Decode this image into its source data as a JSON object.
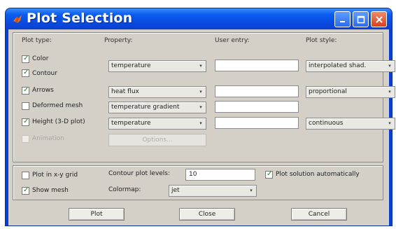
{
  "window": {
    "title": "Plot Selection",
    "title_bar_color": "#0a4ae0",
    "close_button_color": "#d8401e",
    "logo_icon": "matlab-logo-icon",
    "minimize_icon": "minimize-icon",
    "maximize_icon": "maximize-icon",
    "close_icon": "close-icon"
  },
  "headers": {
    "plot_type": "Plot type:",
    "property": "Property:",
    "user_entry": "User entry:",
    "plot_style": "Plot style:"
  },
  "rows": [
    {
      "label": "Color",
      "checked": true,
      "enabled": true
    },
    {
      "label": "Contour",
      "checked": true,
      "enabled": true
    },
    {
      "label": "Arrows",
      "checked": true,
      "enabled": true
    },
    {
      "label": "Deformed mesh",
      "checked": false,
      "enabled": true
    },
    {
      "label": "Height (3-D plot)",
      "checked": true,
      "enabled": true
    },
    {
      "label": "Animation",
      "checked": false,
      "enabled": false
    }
  ],
  "properties": {
    "color_contour": "temperature",
    "arrows": "heat flux",
    "deformed_mesh": "temperature gradient",
    "height": "temperature"
  },
  "user_entries": {
    "color_contour": "",
    "arrows": "",
    "deformed_mesh": "",
    "height": ""
  },
  "plot_styles": {
    "color_contour": "interpolated shad.",
    "arrows": "proportional",
    "height": "continuous"
  },
  "options_button": "Options...",
  "bottom": {
    "plot_grid_label": "Plot in x-y grid",
    "plot_grid_checked": false,
    "show_mesh_label": "Show mesh",
    "show_mesh_checked": true,
    "contour_levels_label": "Contour plot levels:",
    "contour_levels_value": "10",
    "plot_auto_label": "Plot solution automatically",
    "plot_auto_checked": true,
    "colormap_label": "Colormap:",
    "colormap_value": "jet"
  },
  "buttons": {
    "plot": "Plot",
    "close": "Close",
    "cancel": "Cancel"
  },
  "tick_glyph": "✓",
  "dropdown_arrow_glyph": "▾"
}
